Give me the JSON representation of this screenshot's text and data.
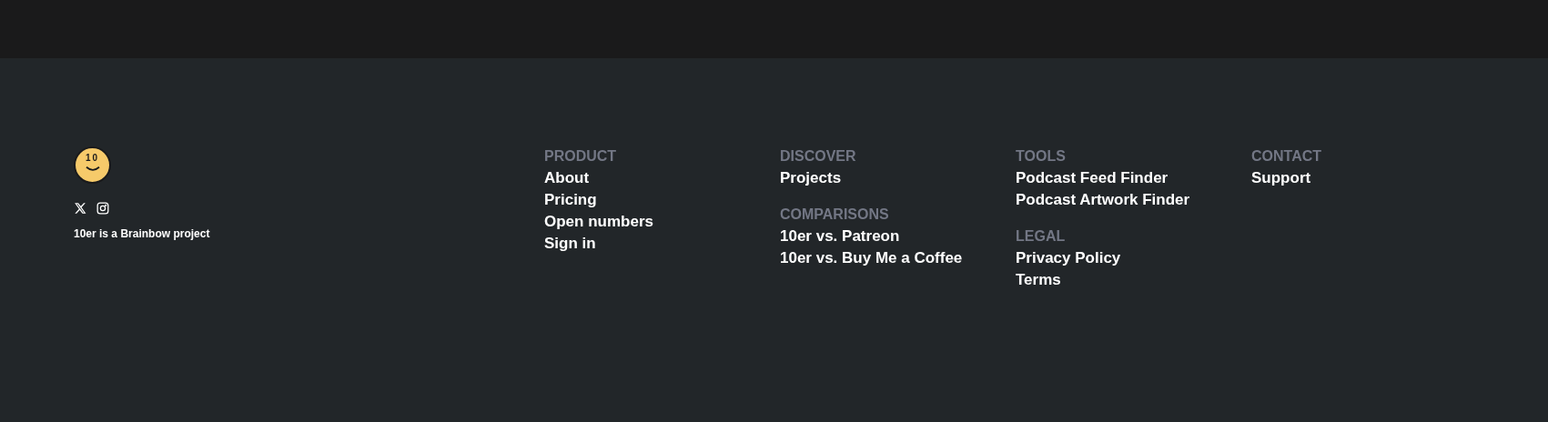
{
  "logo": {
    "text": "10"
  },
  "social": [
    {
      "kind": "x"
    },
    {
      "kind": "instagram"
    }
  ],
  "tagline": "10er is a Brainbow project",
  "columns": [
    {
      "sections": [
        {
          "heading": "PRODUCT",
          "links": [
            "About",
            "Pricing",
            "Open numbers",
            "Sign in"
          ]
        }
      ]
    },
    {
      "sections": [
        {
          "heading": "DISCOVER",
          "links": [
            "Projects"
          ]
        },
        {
          "heading": "COMPARISONS",
          "links": [
            "10er vs. Patreon",
            "10er vs. Buy Me a Coffee"
          ]
        }
      ]
    },
    {
      "sections": [
        {
          "heading": "TOOLS",
          "links": [
            "Podcast Feed Finder",
            "Podcast Artwork Finder"
          ]
        },
        {
          "heading": "LEGAL",
          "links": [
            "Privacy Policy",
            "Terms"
          ]
        }
      ]
    },
    {
      "sections": [
        {
          "heading": "CONTACT",
          "links": [
            "Support"
          ]
        }
      ]
    }
  ]
}
